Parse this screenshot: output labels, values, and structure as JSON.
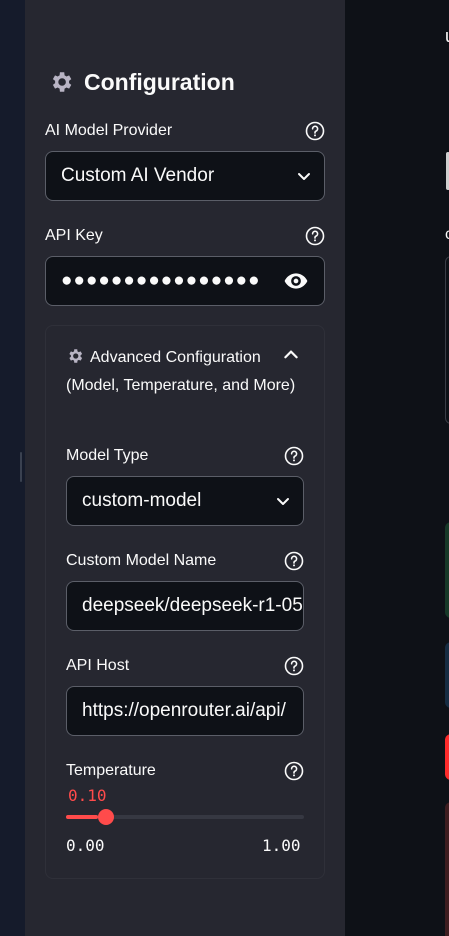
{
  "sidebar": {
    "title": "Configuration",
    "provider": {
      "label": "AI Model Provider",
      "value": "Custom AI Vendor"
    },
    "api_key": {
      "label": "API Key",
      "value": "●●●●●●●●●●●●●●●●"
    },
    "advanced": {
      "title": "Advanced Configuration (Model, Temperature, and More)",
      "model_type": {
        "label": "Model Type",
        "value": "custom-model"
      },
      "custom_model_name": {
        "label": "Custom Model Name",
        "value": "deepseek/deepseek-r1-05"
      },
      "api_host": {
        "label": "API Host",
        "value": "https://openrouter.ai/api/"
      },
      "temperature": {
        "label": "Temperature",
        "value": "0.10",
        "min": "0.00",
        "max": "1.00",
        "fraction": 0.1
      }
    }
  },
  "main": {
    "letter_top": "u",
    "letter_mid": "c"
  },
  "colors": {
    "accent": "#ff4b4b",
    "sidebar_bg": "#262730",
    "app_bg": "#0e1117"
  },
  "icons": [
    "gear-icon",
    "help-icon",
    "chevron-down-icon",
    "eye-icon",
    "chevron-up-icon"
  ]
}
